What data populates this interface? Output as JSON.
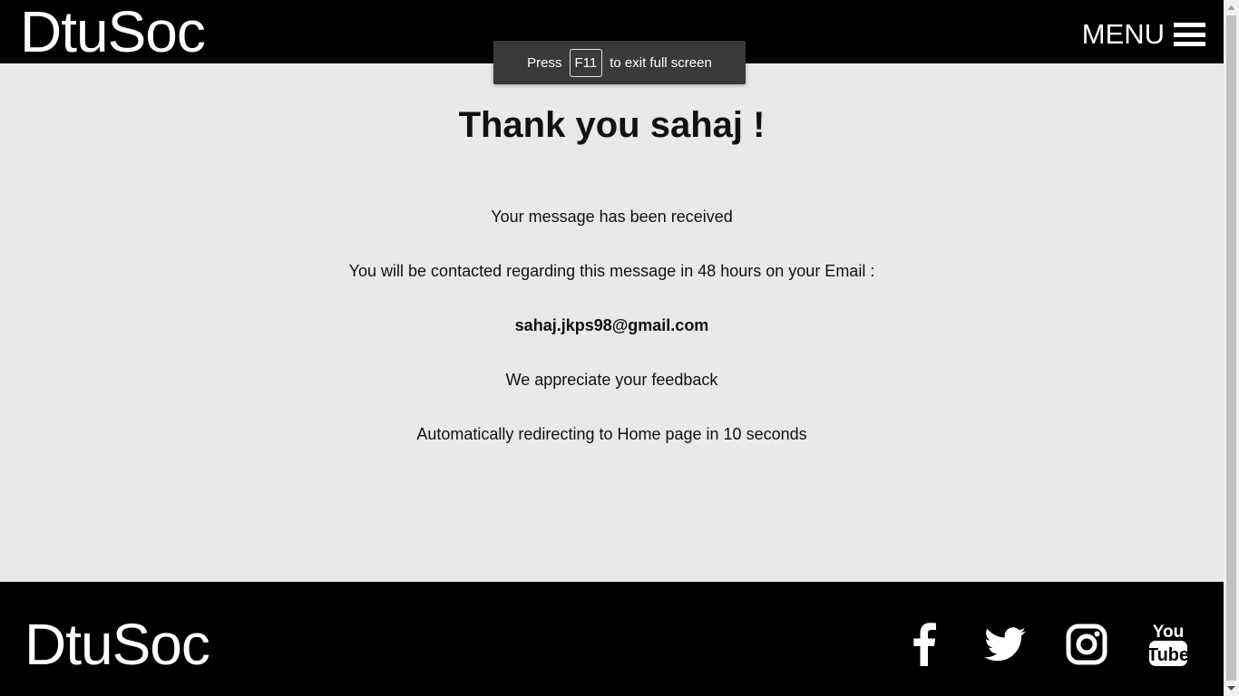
{
  "header": {
    "brand": "DtuSoc",
    "menu_label": "MENU"
  },
  "fullscreen_toast": {
    "prefix": "Press",
    "key": "F11",
    "suffix": "to exit full screen"
  },
  "main": {
    "title": "Thank you sahaj !",
    "received": "Your message has been received",
    "contact_notice": "You will be contacted regarding this message in 48 hours on your Email :",
    "email": "sahaj.jkps98@gmail.com",
    "appreciation": "We appreciate your feedback",
    "redirect_notice": "Automatically redirecting to Home page in 10 seconds"
  },
  "footer": {
    "brand": "DtuSoc",
    "social_icons": [
      "facebook-icon",
      "twitter-icon",
      "instagram-icon",
      "youtube-icon"
    ],
    "youtube_icon_text": [
      "You",
      "Tube"
    ]
  },
  "colors": {
    "bar_background": "#000000",
    "page_background": "#e9e9e9",
    "toast_background": "#3a3a3d"
  }
}
